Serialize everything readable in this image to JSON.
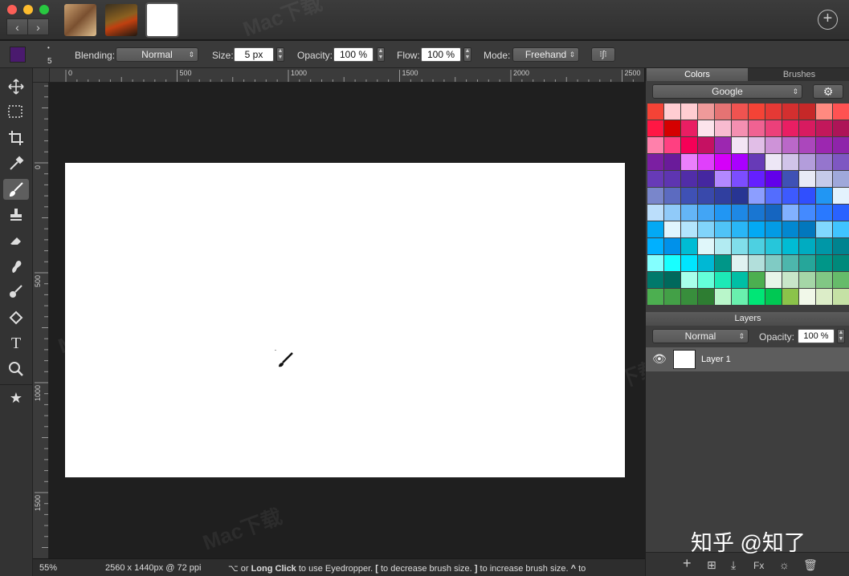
{
  "window": {
    "thumbnails": [
      "thumbnail-cat",
      "thumbnail-photo",
      "thumbnail-blank"
    ],
    "add_icon": "+"
  },
  "options": {
    "brush_size_value": "5",
    "blending_label": "Blending:",
    "blending_value": "Normal",
    "size_label": "Size:",
    "size_value": "5 px",
    "opacity_label": "Opacity:",
    "opacity_value": "100 %",
    "flow_label": "Flow:",
    "flow_value": "100 %",
    "mode_label": "Mode:",
    "mode_value": "Freehand",
    "foreground_color": "#4a1a6e"
  },
  "rulers": {
    "h_ticks": [
      "0",
      "500",
      "1000",
      "1500",
      "2000",
      "2500"
    ],
    "v_ticks": [
      "0",
      "500",
      "1000",
      "1500"
    ]
  },
  "tools": [
    "move-tool",
    "select-tool",
    "crop-tool",
    "eyedropper-tool",
    "brush-tool",
    "stamp-tool",
    "eraser-tool",
    "smudge-tool",
    "dodge-tool",
    "fill-tool",
    "text-tool",
    "zoom-tool",
    "favorites-tool"
  ],
  "status": {
    "zoom": "55%",
    "doc_size": "2560 x 1440px @ 72 ppi",
    "hint_part1": "⌥ or ",
    "hint_bold1": "Long Click",
    "hint_part2": " to use Eyedropper.  ",
    "hint_bold2": "[",
    "hint_part3": " to decrease brush size.  ",
    "hint_bold3": "]",
    "hint_part4": " to increase brush size.  ",
    "hint_bold4": "^",
    "hint_part5": " to"
  },
  "panel": {
    "tab_colors": "Colors",
    "tab_brushes": "Brushes",
    "palette_value": "Google",
    "layers_title": "Layers",
    "layer_blend": "Normal",
    "layer_opacity_label": "Opacity:",
    "layer_opacity_value": "100 %",
    "layer_name": "Layer 1",
    "bottom_fx": "Fx"
  },
  "swatch_colors": [
    "#f44336",
    "#ffcdd2",
    "#ffcdd2",
    "#ef9a9a",
    "#e57373",
    "#ef5350",
    "#f44336",
    "#e53935",
    "#d32f2f",
    "#c62828",
    "#ff8a80",
    "#ff5252",
    "#ff1744",
    "#d50000",
    "#e91e63",
    "#fce4ec",
    "#f8bbd0",
    "#f48fb1",
    "#f06292",
    "#ec407a",
    "#e91e63",
    "#d81b60",
    "#c2185b",
    "#ad1457",
    "#ff80ab",
    "#ff4081",
    "#f50057",
    "#c51162",
    "#9c27b0",
    "#f3e5f5",
    "#e1bee7",
    "#ce93d8",
    "#ba68c8",
    "#ab47bc",
    "#9c27b0",
    "#8e24aa",
    "#7b1fa2",
    "#6a1b9a",
    "#ea80fc",
    "#e040fb",
    "#d500f9",
    "#aa00ff",
    "#673ab7",
    "#ede7f6",
    "#d1c4e9",
    "#b39ddb",
    "#9575cd",
    "#7e57c2",
    "#673ab7",
    "#5e35b1",
    "#512da8",
    "#4527a0",
    "#b388ff",
    "#7c4dff",
    "#651fff",
    "#6200ea",
    "#3f51b5",
    "#e8eaf6",
    "#c5cae9",
    "#9fa8da",
    "#7986cb",
    "#5c6bc0",
    "#3f51b5",
    "#3949ab",
    "#303f9f",
    "#283593",
    "#8c9eff",
    "#536dfe",
    "#3d5afe",
    "#304ffe",
    "#2196f3",
    "#e3f2fd",
    "#bbdefb",
    "#90caf9",
    "#64b5f6",
    "#42a5f5",
    "#2196f3",
    "#1e88e5",
    "#1976d2",
    "#1565c0",
    "#82b1ff",
    "#448aff",
    "#2979ff",
    "#2962ff",
    "#03a9f4",
    "#e1f5fe",
    "#b3e5fc",
    "#81d4fa",
    "#4fc3f7",
    "#29b6f6",
    "#03a9f4",
    "#039be5",
    "#0288d1",
    "#0277bd",
    "#80d8ff",
    "#40c4ff",
    "#00b0ff",
    "#0091ea",
    "#00bcd4",
    "#e0f7fa",
    "#b2ebf2",
    "#80deea",
    "#4dd0e1",
    "#26c6da",
    "#00bcd4",
    "#00acc1",
    "#0097a7",
    "#00838f",
    "#84ffff",
    "#18ffff",
    "#00e5ff",
    "#00b8d4",
    "#009688",
    "#e0f2f1",
    "#b2dfdb",
    "#80cbc4",
    "#4db6ac",
    "#26a69a",
    "#009688",
    "#00897b",
    "#00796b",
    "#00695c",
    "#a7ffeb",
    "#64ffda",
    "#1de9b6",
    "#00bfa5",
    "#4caf50",
    "#e8f5e9",
    "#c8e6c9",
    "#a5d6a7",
    "#81c784",
    "#66bb6a",
    "#4caf50",
    "#43a047",
    "#388e3c",
    "#2e7d32",
    "#b9f6ca",
    "#69f0ae",
    "#00e676",
    "#00c853",
    "#8bc34a",
    "#f1f8e9",
    "#dcedc8",
    "#c5e1a5"
  ]
}
